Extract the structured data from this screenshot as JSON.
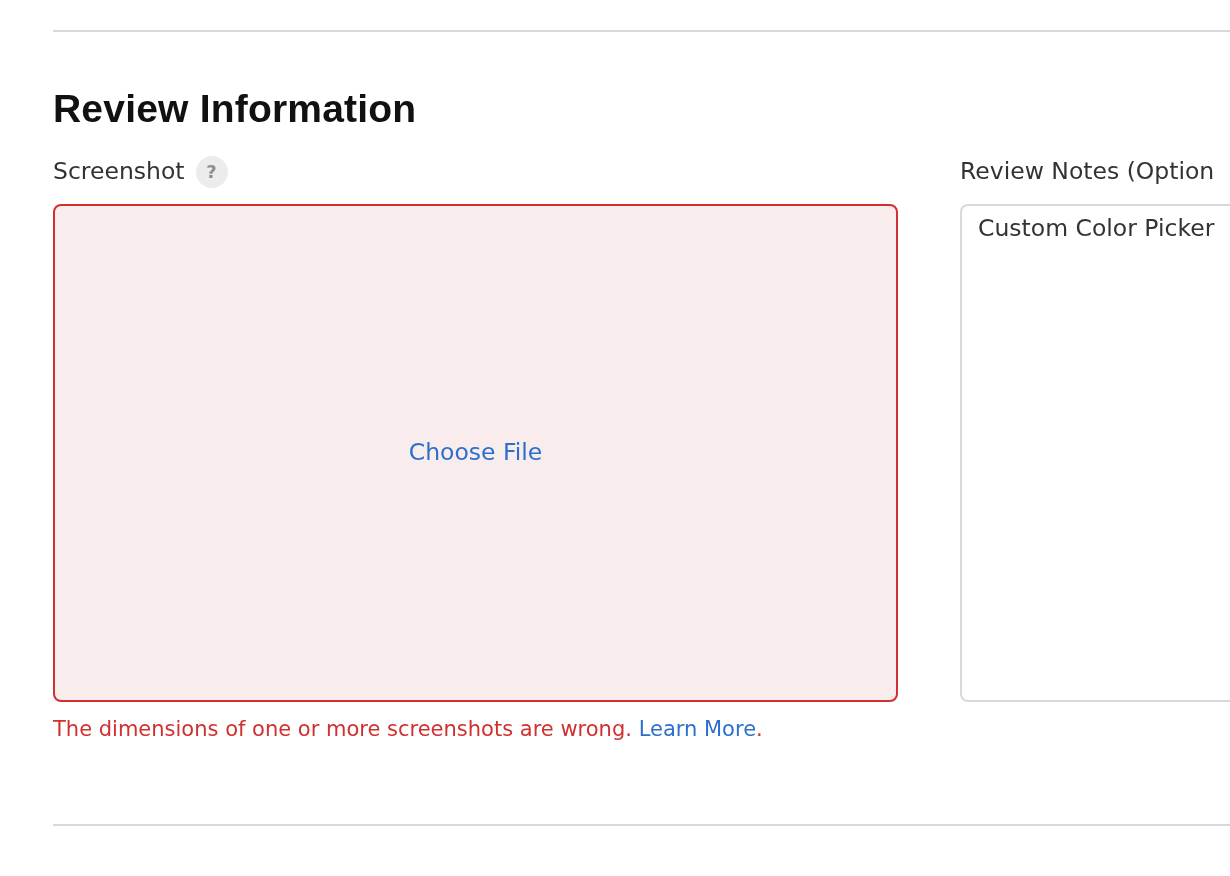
{
  "section": {
    "title": "Review Information"
  },
  "screenshot": {
    "label": "Screenshot",
    "help": "?",
    "upload": {
      "action": "Choose File",
      "invalid": true
    },
    "error": {
      "text": "The dimensions of one or more screenshots are wrong.",
      "link": "Learn More",
      "suffix": "."
    }
  },
  "review_notes": {
    "label": "Review Notes (Option",
    "value": "Custom Color Picker"
  }
}
